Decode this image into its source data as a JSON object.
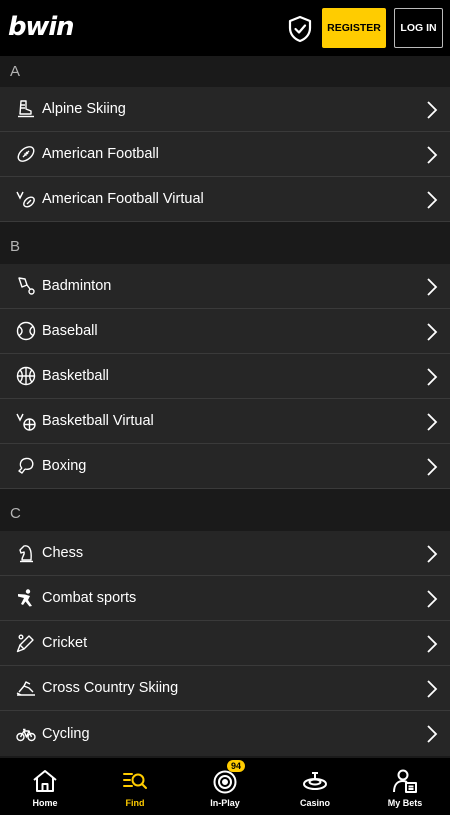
{
  "header": {
    "logo": "bwin",
    "register_label": "REGISTER",
    "login_label": "LOG IN"
  },
  "sections": [
    {
      "letter": "A",
      "items": [
        {
          "label": "Alpine Skiing",
          "icon": "alpine-skiing-icon"
        },
        {
          "label": "American Football",
          "icon": "american-football-icon"
        },
        {
          "label": "American Football Virtual",
          "icon": "virtual-football-icon"
        }
      ]
    },
    {
      "letter": "B",
      "items": [
        {
          "label": "Badminton",
          "icon": "badminton-icon"
        },
        {
          "label": "Baseball",
          "icon": "baseball-icon"
        },
        {
          "label": "Basketball",
          "icon": "basketball-icon"
        },
        {
          "label": "Basketball Virtual",
          "icon": "virtual-basketball-icon"
        },
        {
          "label": "Boxing",
          "icon": "boxing-icon"
        }
      ]
    },
    {
      "letter": "C",
      "items": [
        {
          "label": "Chess",
          "icon": "chess-icon"
        },
        {
          "label": "Combat sports",
          "icon": "combat-sports-icon"
        },
        {
          "label": "Cricket",
          "icon": "cricket-icon"
        },
        {
          "label": "Cross Country Skiing",
          "icon": "cross-country-skiing-icon"
        },
        {
          "label": "Cycling",
          "icon": "cycling-icon"
        }
      ]
    }
  ],
  "bottom_nav": {
    "home": "Home",
    "find": "Find",
    "inplay": "In-Play",
    "inplay_badge": "94",
    "casino": "Casino",
    "mybets": "My Bets"
  },
  "colors": {
    "accent": "#ffcc00",
    "header_bg": "#000000",
    "row_bg": "#262626",
    "page_bg": "#1a1a1a"
  }
}
